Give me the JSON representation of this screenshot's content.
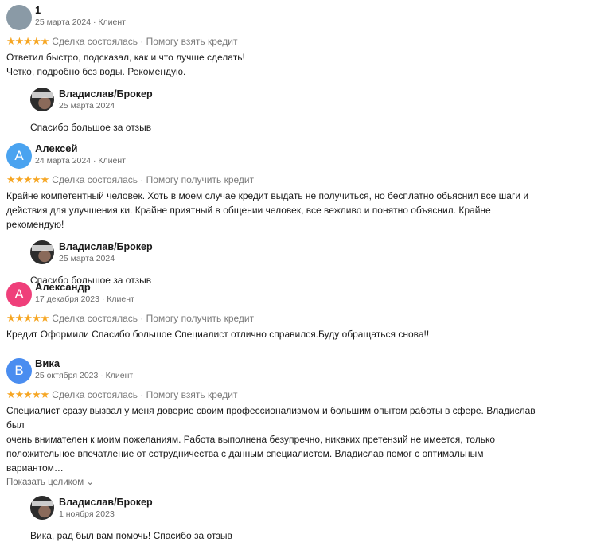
{
  "reviews": [
    {
      "initial": "",
      "avatar_color": "#8a9aa6",
      "name": "1",
      "meta": "25 марта 2024 · Клиент",
      "stars": "★★★★★",
      "tags": "Сделка состоялась · Помогу взять кредит",
      "text_lines": [
        "Ответил быстро, подсказал, как и что лучше сделать!",
        "Четко, подробно без воды. Рекомендую."
      ],
      "reply": {
        "name": "Владислав/Брокер",
        "date": "25 марта 2024",
        "text": "Спасибо большое за отзыв"
      }
    },
    {
      "initial": "А",
      "avatar_color": "#4aa3f0",
      "name": "Алексей",
      "meta": "24 марта 2024 · Клиент",
      "stars": "★★★★★",
      "tags": "Сделка состоялась · Помогу получить кредит",
      "text_lines": [
        "Крайне компетентный человек. Хоть в моем случае кредит выдать не получиться, но бесплатно обьяснил все шаги и",
        "действия для улучшения ки. Крайне приятный в общении человек, все вежливо и понятно объяснил. Крайне рекомендую!"
      ],
      "reply": {
        "name": "Владислав/Брокер",
        "date": "25 марта 2024",
        "text": "Спасибо большое за отзыв"
      }
    },
    {
      "initial": "А",
      "avatar_color": "#ef3f7a",
      "name": "Александр",
      "meta": "17 декабря 2023 · Клиент",
      "stars": "★★★★★",
      "tags": "Сделка состоялась · Помогу получить кредит",
      "text_lines": [
        "Кредит Оформили Спасибо большое Специалист отлично справился.Буду обращаться снова!!"
      ]
    },
    {
      "initial": "В",
      "avatar_color": "#4a8df0",
      "name": "Вика",
      "meta": "25 октября 2023 · Клиент",
      "stars": "★★★★★",
      "tags": "Сделка состоялась · Помогу взять кредит",
      "text_lines": [
        "Специалист сразу вызвал у меня доверие своим профессионализмом и большим опытом работы в сфере. Владислав был",
        "очень внимателен к моим пожеланиям. Работа выполнена безупречно, никаких претензий не имеется, только",
        "положительное впечатление от сотрудничества с данным специалистом. Владислав помог с оптимальным вариантом…"
      ],
      "show_more": "Показать целиком ⌄",
      "reply": {
        "name": "Владислав/Брокер",
        "date": "1 ноября 2023",
        "text": "Вика, рад был вам помочь! Спасибо за отзыв"
      }
    }
  ]
}
